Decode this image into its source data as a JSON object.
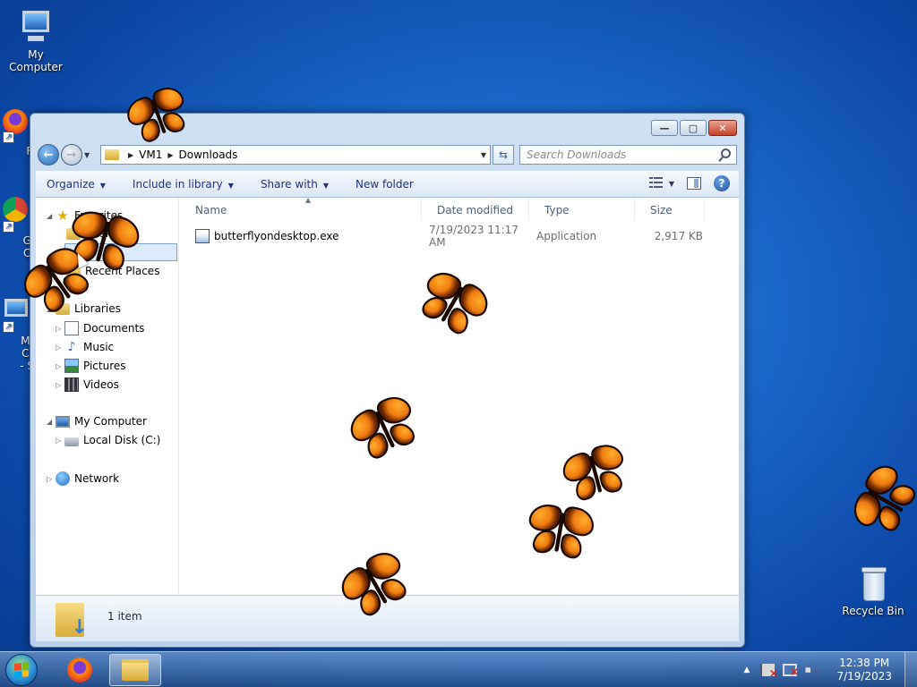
{
  "desktop": {
    "icons": [
      {
        "label": "My Computer"
      },
      {
        "label": "Fi"
      },
      {
        "label": "Go"
      },
      {
        "label": "Ch"
      },
      {
        "label": "My Co"
      },
      {
        "label": "- Sh"
      },
      {
        "label": "Recycle Bin"
      }
    ]
  },
  "window": {
    "caption": {
      "minimize": "—",
      "maximize": "▢",
      "close": "✕"
    },
    "address": {
      "crumbs": [
        "VM1",
        "Downloads"
      ]
    },
    "search": {
      "placeholder": "Search Downloads"
    },
    "commands": [
      {
        "label": "Organize"
      },
      {
        "label": "Include in library"
      },
      {
        "label": "Share with"
      },
      {
        "label": "New folder"
      }
    ],
    "nav_tree": {
      "favorites": "Favorites",
      "desktop": "Desktop",
      "recent_places": "Recent Places",
      "libraries": "Libraries",
      "documents": "Documents",
      "music": "Music",
      "pictures": "Pictures",
      "videos": "Videos",
      "my_computer": "My Computer",
      "local_disk": "Local Disk (C:)",
      "network": "Network"
    },
    "columns": [
      "Name",
      "Date modified",
      "Type",
      "Size"
    ],
    "files": [
      {
        "name": "butterflyondesktop.exe",
        "date": "7/19/2023 11:17 AM",
        "type": "Application",
        "size": "2,917 KB"
      }
    ],
    "status": {
      "item_count": "1 item"
    }
  },
  "taskbar": {
    "clock_time": "12:38 PM",
    "clock_date": "7/19/2023"
  },
  "icons": {
    "back": "back-arrow-icon",
    "forward": "forward-arrow-icon",
    "refresh": "refresh-icon",
    "search": "search-icon",
    "help": "help-icon"
  },
  "colors": {
    "desktop_blue": "#1a66c7",
    "command_text": "#1e3287",
    "butterfly_orange": "#f07c10"
  }
}
